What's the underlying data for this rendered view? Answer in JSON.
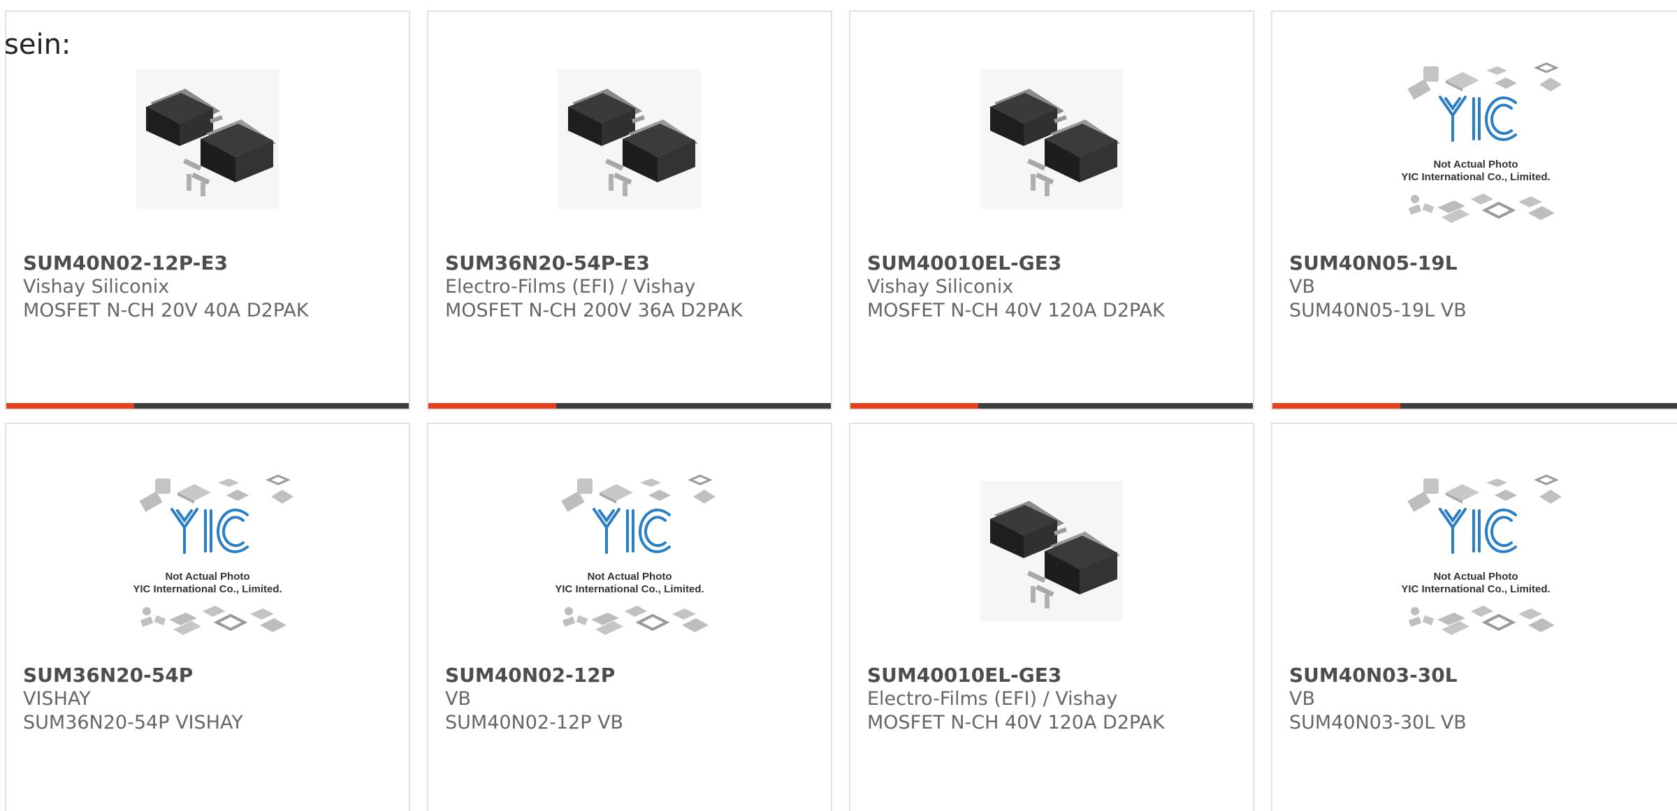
{
  "intro_text": "sein:",
  "colors": {
    "accent": "#e8401c",
    "bar": "#3e3e3e",
    "card_border": "#e2e2e2",
    "yic_blue": "#2a7fc4"
  },
  "placeholder": {
    "line1": "Not Actual Photo",
    "line2": "YIC International Co., Limited."
  },
  "cards": [
    {
      "title": "SUM40N02-12P-E3",
      "manufacturer": "Vishay Siliconix",
      "description": "MOSFET N-CH 20V 40A D2PAK",
      "image": "d2pak-photo"
    },
    {
      "title": "SUM36N20-54P-E3",
      "manufacturer": "Electro-Films (EFI) / Vishay",
      "description": "MOSFET N-CH 200V 36A D2PAK",
      "image": "d2pak-photo"
    },
    {
      "title": "SUM40010EL-GE3",
      "manufacturer": "Vishay Siliconix",
      "description": "MOSFET N-CH 40V 120A D2PAK",
      "image": "d2pak-photo"
    },
    {
      "title": "SUM40N05-19L",
      "manufacturer": "VB",
      "description": "SUM40N05-19L VB",
      "image": "yic-placeholder"
    },
    {
      "title": "SUM36N20-54P",
      "manufacturer": "VISHAY",
      "description": "SUM36N20-54P VISHAY",
      "image": "yic-placeholder"
    },
    {
      "title": "SUM40N02-12P",
      "manufacturer": "VB",
      "description": "SUM40N02-12P VB",
      "image": "yic-placeholder"
    },
    {
      "title": "SUM40010EL-GE3",
      "manufacturer": "Electro-Films (EFI) / Vishay",
      "description": "MOSFET N-CH 40V 120A D2PAK",
      "image": "d2pak-photo"
    },
    {
      "title": "SUM40N03-30L",
      "manufacturer": "VB",
      "description": "SUM40N03-30L VB",
      "image": "yic-placeholder"
    }
  ]
}
